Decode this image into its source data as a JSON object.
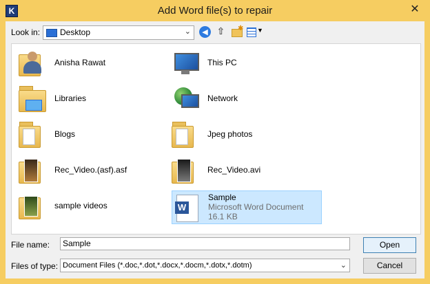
{
  "window": {
    "title": "Add Word file(s) to repair",
    "app_icon_letter": "K",
    "close_glyph": "✕"
  },
  "toolbar": {
    "look_in_label": "Look in:",
    "look_in_value": "Desktop",
    "dropdown_glyph": "⌄"
  },
  "files": [
    {
      "name": "Anisha Rawat",
      "icon": "user-folder-icon"
    },
    {
      "name": "This PC",
      "icon": "computer-icon"
    },
    {
      "name": "Libraries",
      "icon": "libraries-icon"
    },
    {
      "name": "Network",
      "icon": "network-icon"
    },
    {
      "name": "Blogs",
      "icon": "folder-icon"
    },
    {
      "name": "Jpeg photos",
      "icon": "folder-icon"
    },
    {
      "name": "Rec_Video.(asf).asf",
      "icon": "video-file-icon"
    },
    {
      "name": "Rec_Video.avi",
      "icon": "video-file-icon"
    },
    {
      "name": "sample videos",
      "icon": "folder-icon"
    },
    {
      "name": "Sample",
      "type": "Microsoft Word Document",
      "size": "16.1 KB",
      "icon": "word-document-icon",
      "selected": true
    }
  ],
  "footer": {
    "file_name_label": "File name:",
    "file_name_value": "Sample",
    "files_of_type_label": "Files of type:",
    "files_of_type_value": "Document Files (*.doc,*.dot,*.docx,*.docm,*.dotx,*.dotm)",
    "open_label": "Open",
    "cancel_label": "Cancel"
  }
}
